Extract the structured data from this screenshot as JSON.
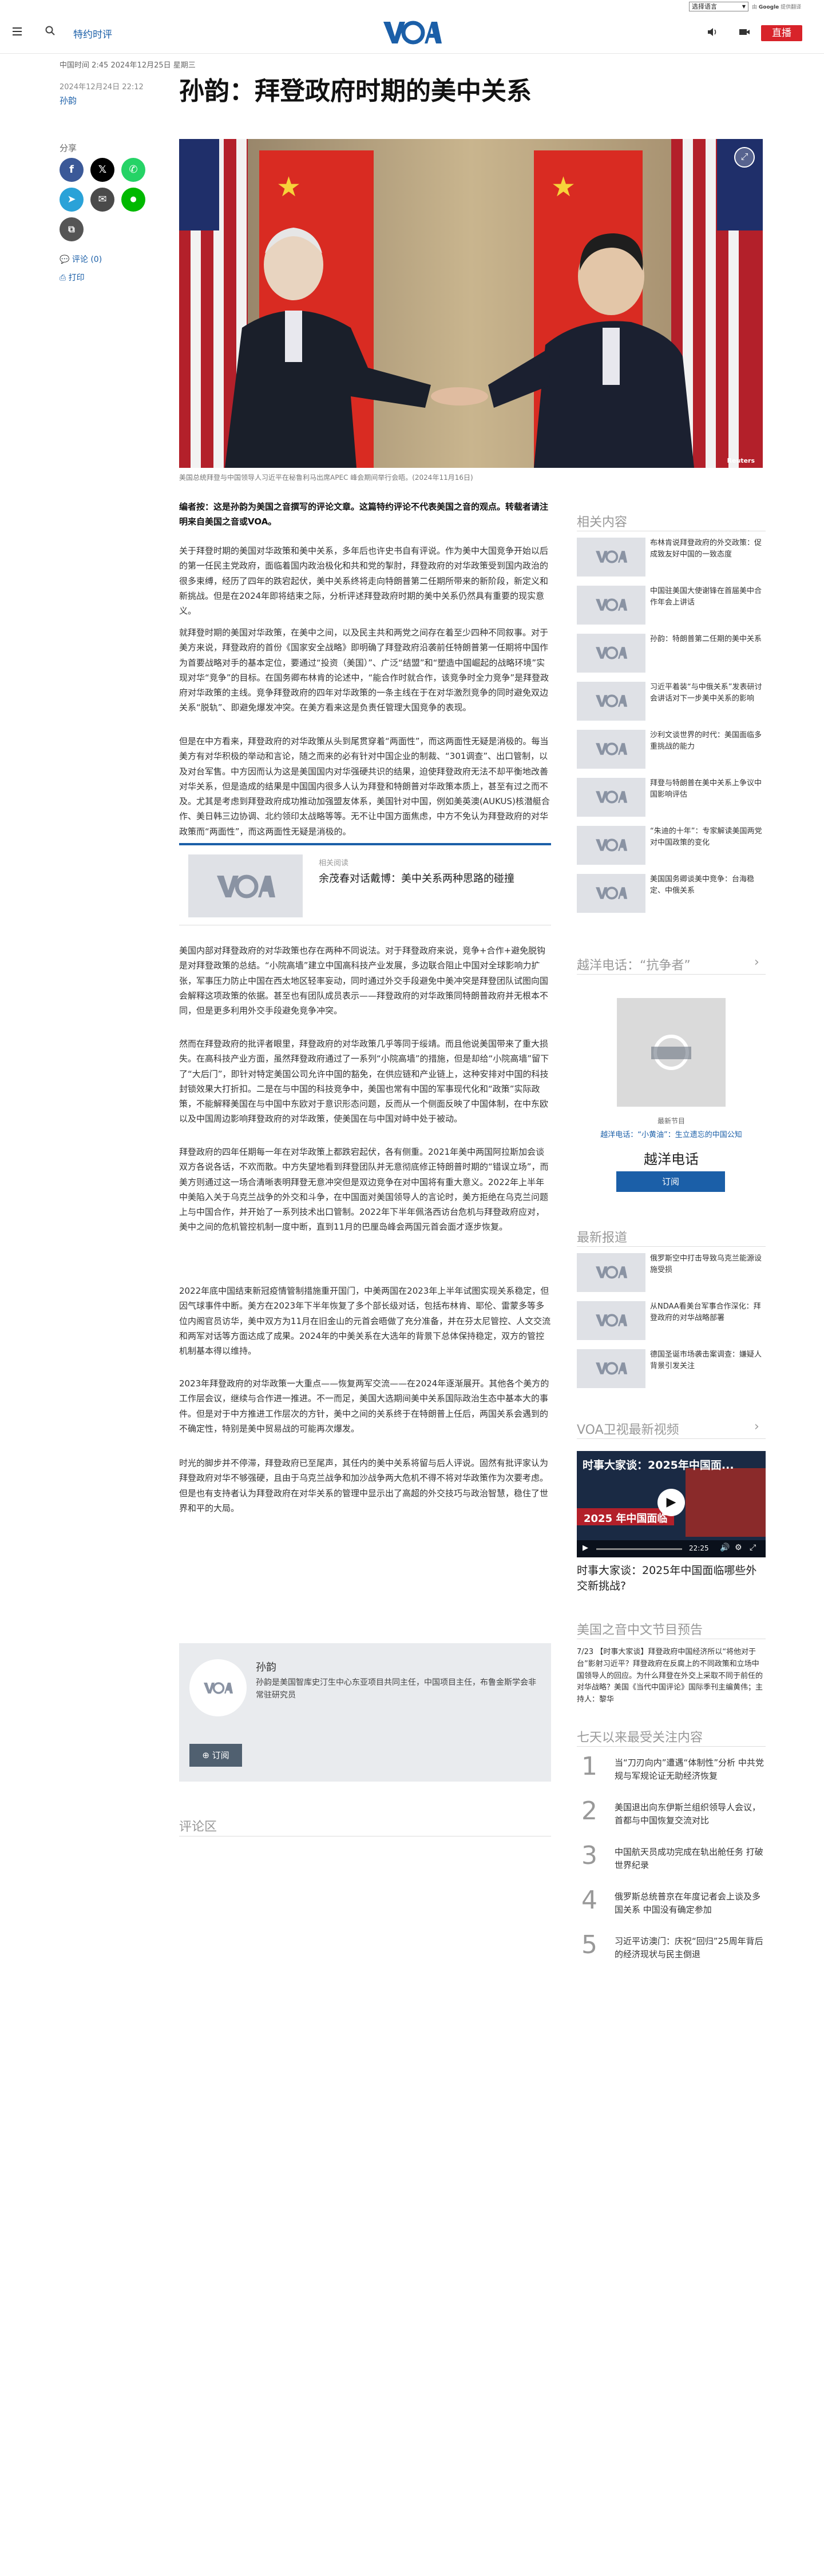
{
  "top_bar": {
    "language_select": "选择语言",
    "powered_by_prefix": "由",
    "powered_by_google": "Google",
    "powered_by_suffix": "提供翻译"
  },
  "header": {
    "section": "特约时评",
    "live_label": "直播"
  },
  "article": {
    "dateline": "中国时间 2:45 2024年12月25日 星期三",
    "published": "2024年12月24日 22:12",
    "author_link": "孙韵",
    "headline": "孙韵：拜登政府时期的美中关系",
    "share_label": "分享",
    "comment_link": "评论 (0)",
    "print_link": "打印",
    "photo_credit": "Reuters",
    "caption": "美国总统拜登与中国领导人习近平在秘鲁利马出席APEC 峰会期间举行会晤。(2024年11月16日)",
    "editor_note": "编者按：这是孙韵为美国之音撰写的评论文章。这篇特约评论不代表美国之音的观点。转载者请注明来自美国之音或VOA。",
    "paragraphs_a": [
      "关于拜登时期的美国对华政策和美中关系，多年后也许史书自有评说。作为美中大国竞争开始以后的第一任民主党政府，面临着国内政治极化和共和党的掣肘，拜登政府的对华政策受到国内政治的很多束缚，经历了四年的跌宕起伏，美中关系终将走向特朗普第二任期所带来的新阶段，新定义和新挑战。但是在2024年即将结束之际，分析评述拜登政府时期的美中关系仍然具有重要的现实意义。",
      "就拜登时期的美国对华政策，在美中之间，以及民主共和两党之间存在着至少四种不同叙事。对于美方来说，拜登政府的首份《国家安全战略》即明确了拜登政府沿袭前任特朗普第一任期将中国作为首要战略对手的基本定位，要通过“投资（美国）”、广泛“结盟”和“塑造中国崛起的战略环境”实现对华“竞争”的目标。在国务卿布林肯的论述中，“能合作时就合作，该竞争时全力竞争”是拜登政府对华政策的主线。竞争拜登政府的四年对华政策的一条主线在于在对华激烈竞争的同时避免双边关系“脱轨”、即避免爆发冲突。在美方看来这是负责任管理大国竞争的表现。",
      "但是在中方看来，拜登政府的对华政策从头到尾贯穿着“两面性”，而这两面性无疑是消极的。每当美方有对华积极的举动和言论，随之而来的必有针对中国企业的制裁、“301调查”、出口管制，以及对台军售。中方因而认为这是美国国内对华强硬共识的结果，迫使拜登政府无法不却平衡地改善对华关系，但是造成的结果是中国国内很多人认为拜登和特朗普对华政策本质上，甚至有过之而不及。尤其是考虑到拜登政府成功推动加强盟友体系，美国针对中国，例如美英澳(AUKUS)核潜艇合作、美日韩三边协调、北约领印太战略等等。无不让中国方面焦虑，中方不免认为拜登政府的对华政策而“两面性”，而这两面性无疑是消极的。"
    ],
    "related": {
      "label": "相关阅读",
      "title": "余茂春对话戴博：美中关系两种思路的碰撞"
    },
    "paragraphs_b": [
      "美国内部对拜登政府的对华政策也存在两种不同说法。对于拜登政府来说，竞争+合作+避免脱钩是对拜登政策的总结。“小院高墙”建立中国高科技产业发展，多边联合阻止中国对全球影响力扩张，军事压力防止中国在西太地区轻率妄动，同时通过外交手段避免中美冲突是拜登团队试图向国会解释这项政策的依据。甚至也有团队成员表示——拜登政府的对华政策同特朗普政府并无根本不同，但是更多利用外交手段避免竞争冲突。",
      "然而在拜登政府的批评者眼里，拜登政府的对华政策几乎等同于绥靖。而且他说美国带来了重大损失。在高科技产业方面，虽然拜登政府通过了一系列“小院高墙”的措施，但是却给“小院高墙”留下了“大后门”，即针对特定美国公司允许中国的豁免，在供应链和产业链上，这种安排对中国的科技封锁效果大打折扣。二是在与中国的科技竞争中，美国也常有中国的军事现代化和“政策”实际政策，不能解释美国在与中国中东欧对于意识形态问题，反而从一个侧面反映了中国体制，在中东欧以及中国周边影响拜登政府的对华政策，使美国在与中国对峙中处于被动。",
      "拜登政府的四年任期每一年在对华政策上都跌宕起伏，各有侧重。2021年美中两国阿拉斯加会谈双方各说各话，不欢而散。中方失望地看到拜登团队并无意彻底修正特朗普时期的“错误立场”，而美方则通过这一场合清晰表明拜登无意冲突但是双边竞争在对中国将有重大意义。2022年上半年中美陷入关于乌克兰战争的外交和斗争，在中国面对美国领导人的言论时，美方拒绝在乌克兰问题上与中国合作，并开始了一系列技术出口管制。2022年下半年佩洛西访台危机与拜登政府应对，美中之间的危机管控机制一度中断，直到11月的巴厘岛峰会两国元首会面才逐步恢复。",
      "2022年底中国结束新冠疫情管制措施重开国门，中美两国在2023年上半年试图实现关系稳定，但因气球事件中断。美方在2023年下半年恢复了多个部长级对话，包括布林肯、耶伦、雷蒙多等多位内阁官员访华，美中双方为11月在旧金山的元首会晤做了充分准备，并在芬太尼管控、人文交流和两军对话等方面达成了成果。2024年的中美关系在大选年的背景下总体保持稳定，双方的管控机制基本得以维持。",
      "2023年拜登政府的对华政策一大重点——恢复两军交流——在2024年逐渐展开。其他各个美方的工作层会议，继续与合作进一推进。不一而足，美国大选期间美中关系国际政治生态中基本大的事件。但是对于中方推进工作层次的方针，美中之间的关系终于在特朗普上任后，两国关系会遇到的不确定性，特别是美中贸易战的可能再次爆发。",
      "时光的脚步并不停滞，拜登政府已至尾声，其任内的美中关系将留与后人评说。固然有批评家认为拜登政府对华不够强硬，且由于乌克兰战争和加沙战争两大危机不得不将对华政策作为次要考虑。但是也有支持者认为拜登政府在对华关系的管理中显示出了高超的外交技巧与政治智慧，稳住了世界和平的大局。"
    ],
    "author": {
      "name": "孙韵",
      "bio": "孙韵是美国智库史汀生中心东亚项目共同主任，中国项目主任，布鲁金斯学会非常驻研究员",
      "subscribe": "订阅"
    },
    "comments_heading": "评论区"
  },
  "rail": {
    "related_heading": "相关内容",
    "related_items": [
      "布林肯说拜登政府的外交政策：促成致友好中国的一致态度",
      "中国驻美国大使谢锋在首届美中合作年会上讲话",
      "孙韵：特朗普第二任期的美中关系",
      "习近平着装“与中俄关系”发表研讨会讲话对下一步美中关系的影响",
      "沙利文谈世界的时代：美国面临多重挑战的能力",
      "拜登与特朗普在美中关系上争议中国影响评估",
      "“朱迪的十年”：专家解读美国两党对中国政策的变化",
      "美国国务卿谈美中竞争：台海稳定、中俄关系"
    ],
    "podcast_heading": "越洋电话：“抗争者”",
    "podcast_latest": "最新节目",
    "podcast_episode": "越洋电话：“小黄油”：生立遗忘的中国公知",
    "podcast_name": "越洋电话",
    "podcast_subscribe": "订阅",
    "news_heading": "最新报道",
    "news_items": [
      "俄罗斯空中打击导致乌克兰能源设施受损",
      "从NDAA看美台军事合作深化：拜登政府的对华战略部署",
      "德国圣诞市场袭击案调查：嫌疑人背景引发关注"
    ],
    "tv_heading": "VOA卫视最新视频",
    "tv_overlay": "时事大家谈：2025年中国面...",
    "tv_time": "22:25",
    "tv_year_label": "2025 年中国面临",
    "tv_title": "时事大家谈：2025年中国面临哪些外交新挑战?",
    "radio_heading": "美国之音中文节目预告",
    "radio_text": "7/23 【时事大家谈】拜登政府中国经济所以“将他对于台”影射习近平？拜登政府在反腐上的不同政策和立场中国领导人的回应。为什么拜登在外交上采取不同于前任的对华战略？美国《当代中国评论》国际季刊主编黄伟；主持人：黎华",
    "popular_heading": "七天以来最受关注内容",
    "popular_items": [
      "当“刀刃向内”遭遇“体制性”分析 中共党规与军规论证无助经济恢复",
      "美国退出向东伊斯兰组织领导人会议，首都与中国恢复交流对比",
      "中国航天员成功完成在轨出舱任务 打破世界纪录",
      "俄罗斯总统普京在年度记者会上谈及多国关系 中国没有确定参加",
      "习近平访澳门：庆祝“回归”25周年背后的经济现状与民主倒退"
    ]
  },
  "colors": {
    "accent": "#1b5fa8",
    "live": "#d8232a",
    "facebook": "#3b5998",
    "x": "#000000",
    "whatsapp": "#25d366",
    "telegram": "#2aa2d8",
    "email": "#4a4a4a",
    "line": "#00b900"
  },
  "icons": [
    "menu-icon",
    "search-icon",
    "voa-logo",
    "audio-icon",
    "video-icon",
    "facebook-icon",
    "x-icon",
    "whatsapp-icon",
    "telegram-icon",
    "email-icon",
    "line-icon",
    "copy-link-icon",
    "comment-icon",
    "print-icon",
    "expand-icon",
    "play-icon"
  ]
}
